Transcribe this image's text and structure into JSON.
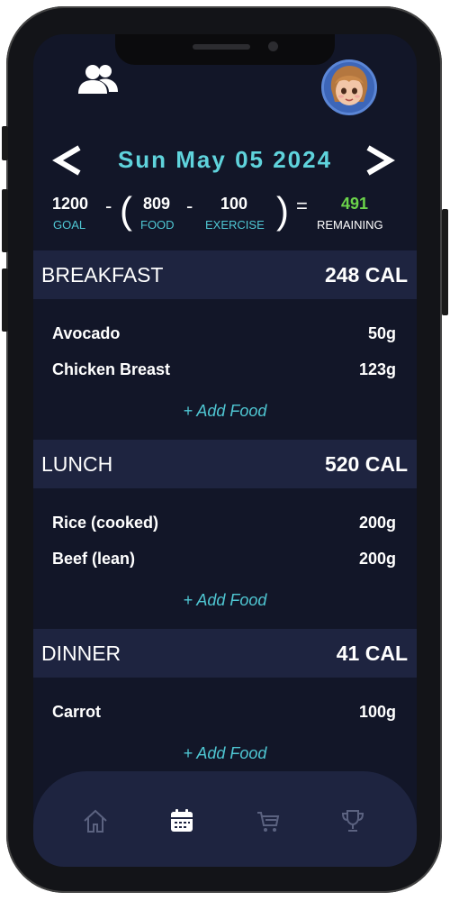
{
  "header": {
    "users_icon": "users-icon",
    "avatar_icon": "avatar"
  },
  "date_nav": {
    "date": "Sun May 05 2024",
    "prev_icon": "chevron-left-icon",
    "next_icon": "chevron-right-icon"
  },
  "summary": {
    "goal_value": "1200",
    "goal_label": "GOAL",
    "minus1": "-",
    "food_value": "809",
    "food_label": "FOOD",
    "minus2": "-",
    "exercise_value": "100",
    "exercise_label": "EXERCISE",
    "equals": "=",
    "remaining_value": "491",
    "remaining_label": "REMAINING"
  },
  "meals": [
    {
      "title": "BREAKFAST",
      "calories": "248 CAL",
      "items": [
        {
          "name": "Avocado",
          "qty": "50g"
        },
        {
          "name": "Chicken Breast",
          "qty": "123g"
        }
      ],
      "add_label": "+ Add Food"
    },
    {
      "title": "LUNCH",
      "calories": "520 CAL",
      "items": [
        {
          "name": "Rice (cooked)",
          "qty": "200g"
        },
        {
          "name": "Beef (lean)",
          "qty": "200g"
        }
      ],
      "add_label": "+ Add Food"
    },
    {
      "title": "DINNER",
      "calories": "41 CAL",
      "items": [
        {
          "name": "Carrot",
          "qty": "100g"
        }
      ],
      "add_label": "+ Add Food"
    }
  ],
  "nav": [
    {
      "icon": "home-icon",
      "active": false
    },
    {
      "icon": "calendar-icon",
      "active": true
    },
    {
      "icon": "cart-icon",
      "active": false
    },
    {
      "icon": "trophy-icon",
      "active": false
    }
  ],
  "colors": {
    "background": "#121628",
    "section": "#1e2440",
    "accent": "#4fc7d3",
    "date": "#5fd3dc",
    "remaining": "#6bd34a"
  }
}
